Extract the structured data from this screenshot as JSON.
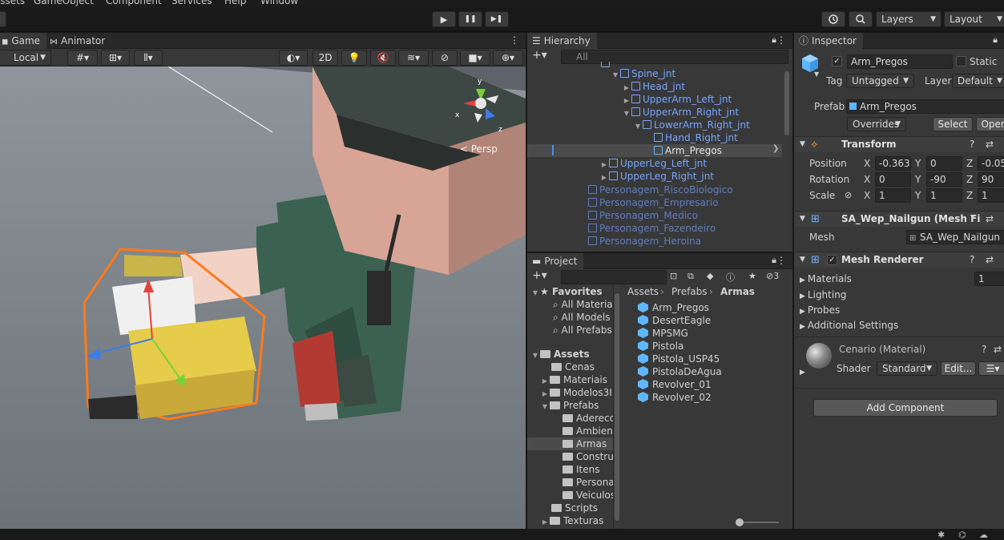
{
  "menu": [
    "Assets",
    "GameObject",
    "Component",
    "Services",
    "Help",
    "Window"
  ],
  "toolbar": {
    "play": "▶",
    "pause": "❚❚",
    "step": "▶❚",
    "layers": "Layers",
    "layout": "Layout"
  },
  "scene": {
    "tabs": [
      "Game",
      "Animator"
    ],
    "pivot": "Local",
    "mode_2d": "2D",
    "persp_label": "< Persp",
    "gizmo_axes": {
      "x": "x",
      "y": "y",
      "z": "z"
    }
  },
  "hierarchy": {
    "title": "Hierarchy",
    "search_placeholder": "All",
    "items": [
      {
        "label": "Spine_jnt"
      },
      {
        "label": "Head_jnt"
      },
      {
        "label": "UpperArm_Left_jnt"
      },
      {
        "label": "UpperArm_Right_jnt"
      },
      {
        "label": "LowerArm_Right_jnt"
      },
      {
        "label": "Hand_Right_jnt"
      },
      {
        "label": "Arm_Pregos"
      },
      {
        "label": "UpperLeg_Left_jnt"
      },
      {
        "label": "UpperLeg_Right_jnt"
      },
      {
        "label": "Personagem_RiscoBiologico"
      },
      {
        "label": "Personagem_Empresario"
      },
      {
        "label": "Personagem_Medico"
      },
      {
        "label": "Personagem_Fazendeiro"
      },
      {
        "label": "Personagem_Heroina"
      }
    ]
  },
  "project": {
    "title": "Project",
    "hidden_count": "3",
    "favorites": {
      "title": "Favorites",
      "items": [
        "All Materia",
        "All Models",
        "All Prefabs"
      ]
    },
    "assets": {
      "title": "Assets",
      "items": [
        "Cenas",
        "Materiais",
        "Modelos3I",
        "Prefabs",
        "Aderecc",
        "Ambient",
        "Armas",
        "Constru",
        "Itens",
        "Persona",
        "Veiculos",
        "Scripts",
        "Texturas"
      ]
    },
    "breadcrumb": [
      "Assets",
      "Prefabs",
      "Armas"
    ],
    "files": [
      "Arm_Pregos",
      "DesertEagle",
      "MPSMG",
      "Pistola",
      "Pistola_USP45",
      "PistolaDeAgua",
      "Revolver_01",
      "Revolver_02"
    ]
  },
  "inspector": {
    "title": "Inspector",
    "object_name": "Arm_Pregos",
    "static_label": "Static",
    "tag_label": "Tag",
    "tag_value": "Untagged",
    "layer_label": "Layer",
    "layer_value": "Default",
    "prefab_label": "Prefab",
    "prefab_value": "Arm_Pregos",
    "overrides": "Overrides",
    "select": "Select",
    "open": "Open",
    "transform": {
      "title": "Transform",
      "position_label": "Position",
      "rotation_label": "Rotation",
      "scale_label": "Scale",
      "position": [
        "-0.363",
        "0",
        "-0.05"
      ],
      "rotation": [
        "0",
        "-90",
        "90"
      ],
      "scale": [
        "1",
        "1",
        "1"
      ],
      "axes": [
        "X",
        "Y",
        "Z"
      ]
    },
    "mesh_filter": {
      "title": "SA_Wep_Nailgun (Mesh Fi",
      "mesh_label": "Mesh",
      "mesh_value": "SA_Wep_Nailgun"
    },
    "mesh_renderer": {
      "title": "Mesh Renderer",
      "materials_label": "Materials",
      "materials_count": "1",
      "lighting": "Lighting",
      "probes": "Probes",
      "additional": "Additional Settings"
    },
    "material": {
      "title": "Cenario (Material)",
      "shader_label": "Shader",
      "shader_value": "Standard",
      "edit": "Edit..."
    },
    "add_component": "Add Component"
  }
}
